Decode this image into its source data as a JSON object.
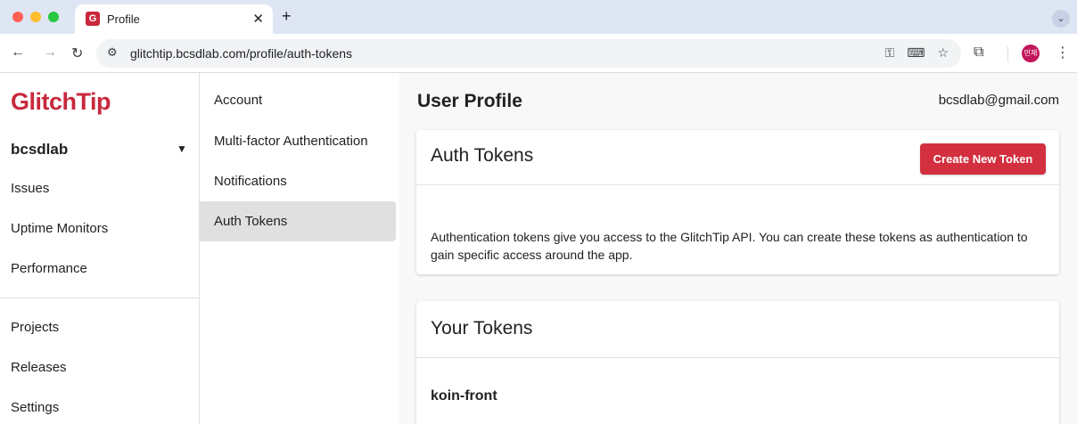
{
  "browser": {
    "tab": {
      "title": "Profile",
      "favicon_letter": "G",
      "close_glyph": "✕"
    },
    "new_tab_glyph": "+",
    "tab_menu_glyph": "⌄",
    "address_bar": {
      "url": "glitchtip.bcsdlab.com/profile/auth-tokens"
    },
    "avatar_text": "민재"
  },
  "app": {
    "logo": "GlitchTip",
    "organization": "bcsdlab",
    "nav": {
      "issues": "Issues",
      "uptime_monitors": "Uptime Monitors",
      "performance": "Performance",
      "projects": "Projects",
      "releases": "Releases",
      "settings": "Settings"
    }
  },
  "profile_nav": {
    "account": "Account",
    "mfa": "Multi-factor Authentication",
    "notifications": "Notifications",
    "auth_tokens": "Auth Tokens"
  },
  "main": {
    "page_title": "User Profile",
    "user_email": "bcsdlab@gmail.com",
    "auth_tokens_card": {
      "title": "Auth Tokens",
      "create_button": "Create New Token",
      "description": "Authentication tokens give you access to the GlitchTip API. You can create these tokens as authentication to gain specific access around the app."
    },
    "your_tokens_card": {
      "title": "Your Tokens",
      "tokens": [
        "koin-front"
      ]
    }
  },
  "colors": {
    "brand": "#c8283c",
    "primary_button": "#d32f3f",
    "active_nav": "#e0e0e0"
  }
}
